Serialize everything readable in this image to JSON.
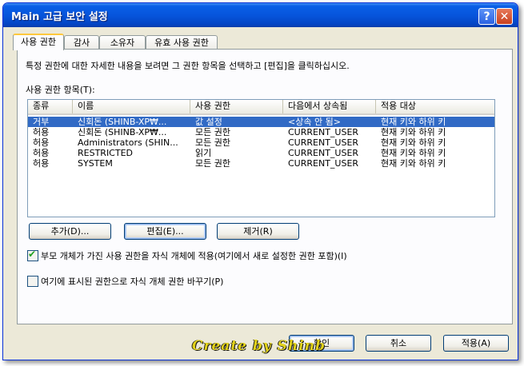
{
  "window": {
    "title": "Main 고급 보안 설정",
    "help_label": "?",
    "close_label": "✕"
  },
  "tabs": [
    {
      "label": "사용 권한"
    },
    {
      "label": "감사"
    },
    {
      "label": "소유자"
    },
    {
      "label": "유효 사용 권한"
    }
  ],
  "permissions": {
    "description": "특정 권한에 대한 자세한 내용을 보려면 그 권한 항목을 선택하고 [편집]을 클릭하십시오.",
    "entries_label": "사용 권한 항목(T):",
    "columns": [
      "종류",
      "이름",
      "사용 권한",
      "다음에서 상속됨",
      "적용 대상"
    ],
    "rows": [
      {
        "type": "거부",
        "name": "신회돈 (SHINB-XP₩...",
        "permission": "값 설정",
        "inherited": "<상속 안 됨>",
        "applies": "현재 키와 하위 키"
      },
      {
        "type": "허용",
        "name": "신회돈 (SHINB-XP₩...",
        "permission": "모든 권한",
        "inherited": "CURRENT_USER",
        "applies": "현재 키와 하위 키"
      },
      {
        "type": "허용",
        "name": "Administrators (SHIN...",
        "permission": "모든 권한",
        "inherited": "CURRENT_USER",
        "applies": "현재 키와 하위 키"
      },
      {
        "type": "허용",
        "name": "RESTRICTED",
        "permission": "읽기",
        "inherited": "CURRENT_USER",
        "applies": "현재 키와 하위 키"
      },
      {
        "type": "허용",
        "name": "SYSTEM",
        "permission": "모든 권한",
        "inherited": "CURRENT_USER",
        "applies": "현재 키와 하위 키"
      }
    ],
    "selected_row": 0,
    "add_label": "추가(D)...",
    "edit_label": "편집(E)...",
    "remove_label": "제거(R)",
    "inherit_checkbox_label": "부모 개체가 가진 사용 권한을 자식 개체에 적용(여기에서 새로 설정한 권한 포함)(I)",
    "inherit_checked": true,
    "replace_checkbox_label": "여기에 표시된 권한으로 자식 개체 권한 바꾸기(P)",
    "replace_checked": false
  },
  "footer": {
    "ok_label": "확인",
    "cancel_label": "취소",
    "apply_label": "적용(A)"
  },
  "watermark": "Create by Shinb",
  "colors": {
    "title_bar": "#0655dc",
    "selection": "#316ac5",
    "dialog_bg": "#ece9d8"
  }
}
